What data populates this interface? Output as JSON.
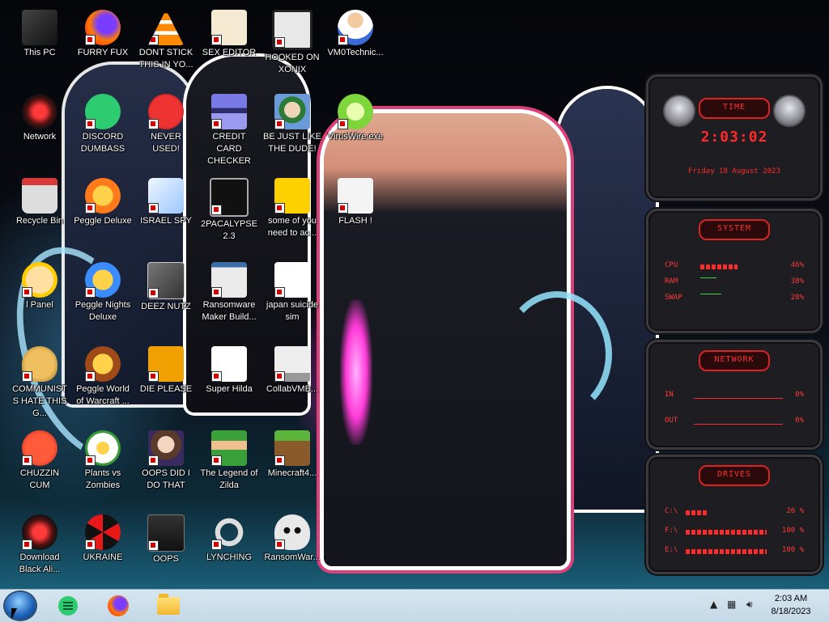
{
  "desktop": {
    "icons": [
      {
        "label": "This PC",
        "icon": "computer-icon"
      },
      {
        "label": "FURRY FUX",
        "icon": "firefox-icon"
      },
      {
        "label": "DONT STICK THIS IN YO...",
        "icon": "vlc-cone-icon"
      },
      {
        "label": "SEX EDITOR",
        "icon": "hxd-editor-icon"
      },
      {
        "label": "HOOKED ON XONIX",
        "icon": "xonix-game-icon"
      },
      {
        "label": "VM0Technic...",
        "icon": "doctor-person-icon"
      },
      {
        "label": "Network",
        "icon": "alienware-network-icon"
      },
      {
        "label": "DISCORD DUMBASS",
        "icon": "notes-app-icon"
      },
      {
        "label": "NEVER USED!",
        "icon": "devcpp-icon"
      },
      {
        "label": "CREDIT CARD CHECKER",
        "icon": "credit-card-icon"
      },
      {
        "label": "BE JUST LIKE THE DUDE!",
        "icon": "elf-portrait-icon"
      },
      {
        "label": "VirusWire.exe",
        "icon": "lime-icon"
      },
      {
        "label": "Recycle Bin",
        "icon": "recycle-bin-icon"
      },
      {
        "label": "Peggle Deluxe",
        "icon": "peggle-icon"
      },
      {
        "label": "ISRAEL SPY",
        "icon": "spy-app-icon"
      },
      {
        "label": "2PACALYPSE 2.3",
        "icon": "terminal-icon"
      },
      {
        "label": "some of you need to ac...",
        "icon": "pixel-creature-icon"
      },
      {
        "label": "FLASH !",
        "icon": "flash-document-icon"
      },
      {
        "label": "l Panel",
        "icon": "cartoon-face-icon"
      },
      {
        "label": "Peggle Nights Deluxe",
        "icon": "peggle-nights-icon"
      },
      {
        "label": "DEEZ NUTZ",
        "icon": "stacked-windows-icon"
      },
      {
        "label": "Ransomware Maker Build...",
        "icon": "app-window-icon"
      },
      {
        "label": "japan suicide sim",
        "icon": "document-icon"
      },
      {
        "label": "COMMUNISTS HATE THIS G...",
        "icon": "money-bag-icon"
      },
      {
        "label": "Peggle World of Warcraft ...",
        "icon": "peggle-wow-icon"
      },
      {
        "label": "DIE PLEASE",
        "icon": "de-letters-icon"
      },
      {
        "label": "Super Hilda",
        "icon": "pixel-cat-icon"
      },
      {
        "label": "CollabVMB...",
        "icon": "monitor-icon"
      },
      {
        "label": "CHUZZIN CUM",
        "icon": "chuzzle-icon"
      },
      {
        "label": "Plants vs Zombies",
        "icon": "flower-icon"
      },
      {
        "label": "OOPS DID I DO THAT",
        "icon": "lady-portrait-icon"
      },
      {
        "label": "The Legend of Zilda",
        "icon": "pixel-hero-icon"
      },
      {
        "label": "Minecraft4...",
        "icon": "grass-block-icon"
      },
      {
        "label": "Download Black Ali...",
        "icon": "alienware-download-icon"
      },
      {
        "label": "UKRAINE",
        "icon": "radiation-icon"
      },
      {
        "label": "OOPS",
        "icon": "dark-file-icon"
      },
      {
        "label": "LYNCHING",
        "icon": "noose-gear-icon"
      },
      {
        "label": "RansomWar...",
        "icon": "skull-icon"
      }
    ]
  },
  "widgets": {
    "time": {
      "title": "TIME",
      "clock": "2:03:02",
      "date": "Friday 18 August 2023"
    },
    "system": {
      "title": "SYSTEM",
      "rows": [
        {
          "key": "CPU",
          "value": "46%",
          "level": 0.46
        },
        {
          "key": "RAM",
          "value": "38%",
          "level": 0.38
        },
        {
          "key": "SWAP",
          "value": "28%",
          "level": 0.28
        }
      ]
    },
    "network": {
      "title": "NETWORK",
      "rows": [
        {
          "key": "IN",
          "value": "0%"
        },
        {
          "key": "OUT",
          "value": "0%"
        }
      ]
    },
    "drives": {
      "title": "DRIVES",
      "rows": [
        {
          "key": "C:\\",
          "value": "26 %",
          "level": 0.26
        },
        {
          "key": "F:\\",
          "value": "100 %",
          "level": 1.0
        },
        {
          "key": "E:\\",
          "value": "100 %",
          "level": 1.0
        }
      ]
    }
  },
  "taskbar": {
    "apps": [
      {
        "name": "notes-app",
        "icon": "notes-app-icon"
      },
      {
        "name": "firefox",
        "icon": "firefox-icon"
      },
      {
        "name": "file-explorer",
        "icon": "folder-icon"
      }
    ],
    "clock": {
      "time": "2:03 AM",
      "date": "8/18/2023"
    }
  },
  "colors": {
    "accent_red": "#ff2a2a",
    "wallpaper_cyan": "#1fb8e0",
    "taskbar": "#d0e2ee"
  }
}
